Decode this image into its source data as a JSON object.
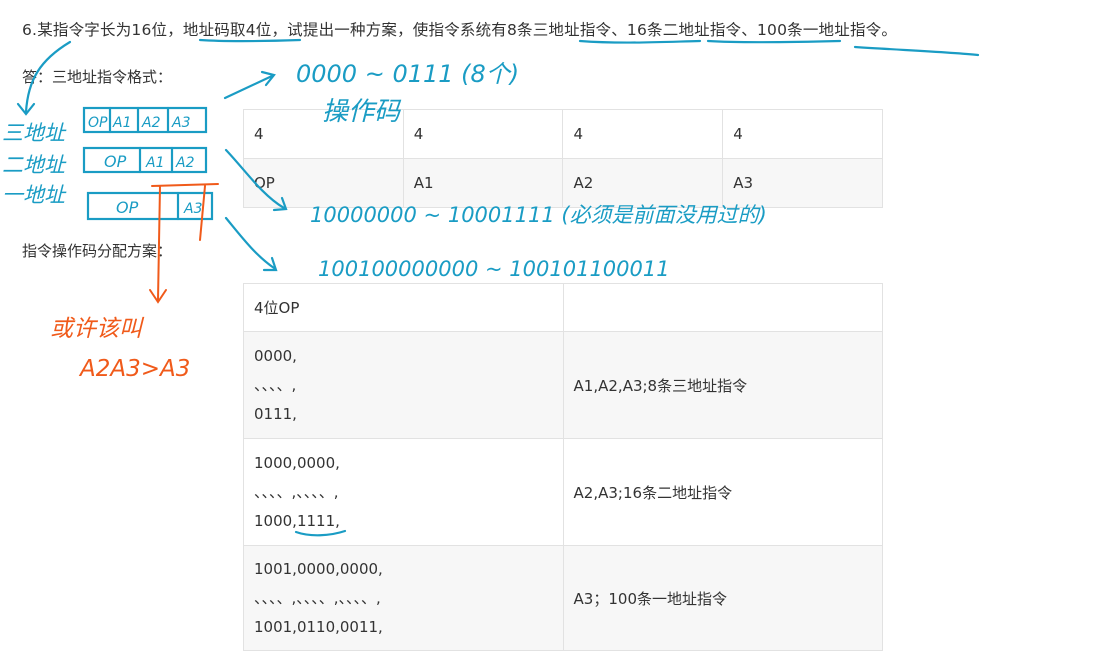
{
  "question": "6.某指令字长为16位，地址码取4位，试提出一种方案，使指令系统有8条三地址指令、16条二地址指令、100条一地址指令。",
  "answer_label": "答：三地址指令格式：",
  "alloc_label": "指令操作码分配方案：",
  "format_table": {
    "widths": [
      "4",
      "4",
      "4",
      "4"
    ],
    "fields": [
      "OP",
      "A1",
      "A2",
      "A3"
    ]
  },
  "alloc_table": {
    "header": [
      "4位OP",
      ""
    ],
    "rows": [
      {
        "codes": [
          "0000,",
          "、、、、,",
          "0111,"
        ],
        "desc": "A1,A2,A3;8条三地址指令"
      },
      {
        "codes": [
          "1000,0000,",
          "、、、、,、、、、,",
          "1000,1111,"
        ],
        "desc": "A2,A3;16条二地址指令"
      },
      {
        "codes": [
          "1001,0000,0000,",
          "、、、、,、、、、,、、、、,",
          "1001,0110,0011,"
        ],
        "desc": "A3；100条一地址指令"
      }
    ]
  },
  "annotations": {
    "range_3addr": "0000 ~ 0111 (8个)",
    "opcode_note": "操作码",
    "label_3addr": "三地址",
    "label_2addr": "二地址",
    "label_1addr": "一地址",
    "box_3addr": [
      "OP",
      "A1",
      "A2",
      "A3"
    ],
    "box_2addr": [
      "OP",
      "A1",
      "A2"
    ],
    "box_1addr": [
      "OP",
      "A3"
    ],
    "range_2addr": "10000000 ~ 10001111 (必须是前面没用过的)",
    "range_1addr": "100100000000 ~ 100101100011",
    "orange_note_1": "或许该叫",
    "orange_note_2": "A2A3>A3",
    "ink_color": "#1a9cc4",
    "orange_color": "#f05a1a"
  }
}
